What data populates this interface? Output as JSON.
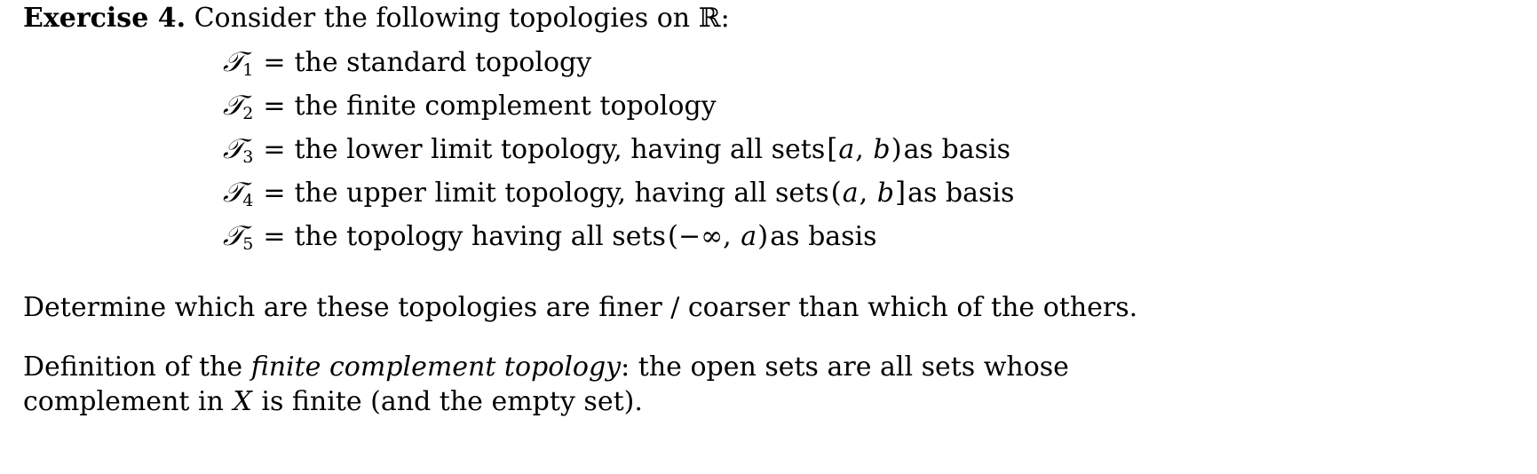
{
  "exercise": {
    "label": "Exercise 4.",
    "prompt": "Consider the following topologies on",
    "space_symbol": "ℝ",
    "colon": ":"
  },
  "topologies": [
    {
      "symbol": "𝒯",
      "subscript": "1",
      "equals": "=",
      "description": "the standard topology",
      "basis_prefix": "",
      "open_bracket": "",
      "var_left": "",
      "comma": "",
      "var_right": "",
      "close_bracket": "",
      "basis_suffix": ""
    },
    {
      "symbol": "𝒯",
      "subscript": "2",
      "equals": "=",
      "description": "the finite complement topology",
      "basis_prefix": "",
      "open_bracket": "",
      "var_left": "",
      "comma": "",
      "var_right": "",
      "close_bracket": "",
      "basis_suffix": ""
    },
    {
      "symbol": "𝒯",
      "subscript": "3",
      "equals": "=",
      "description": "the lower limit topology, having all sets",
      "basis_prefix": "",
      "open_bracket": "[",
      "var_left": "a",
      "comma": ",",
      "var_right": "b",
      "close_bracket": ")",
      "basis_suffix": "as basis"
    },
    {
      "symbol": "𝒯",
      "subscript": "4",
      "equals": "=",
      "description": "the upper limit topology, having all sets",
      "basis_prefix": "",
      "open_bracket": "(",
      "var_left": "a",
      "comma": ",",
      "var_right": "b",
      "close_bracket": "]",
      "basis_suffix": "as basis"
    },
    {
      "symbol": "𝒯",
      "subscript": "5",
      "equals": "=",
      "description": "the topology having all sets",
      "basis_prefix": "",
      "open_bracket": "(",
      "var_left": "−∞",
      "comma": ",",
      "var_right": "a",
      "close_bracket": ")",
      "basis_suffix": "as basis"
    }
  ],
  "determine_paragraph": "Determine which are these topologies are finer / coarser than which of the others.",
  "definition_paragraph": {
    "lead": "Definition of the",
    "term": "finite complement topology",
    "rest_before_var": ": the open sets are all sets whose complement in",
    "variable": "X",
    "rest_after_var": "is finite (and the empty set)."
  }
}
